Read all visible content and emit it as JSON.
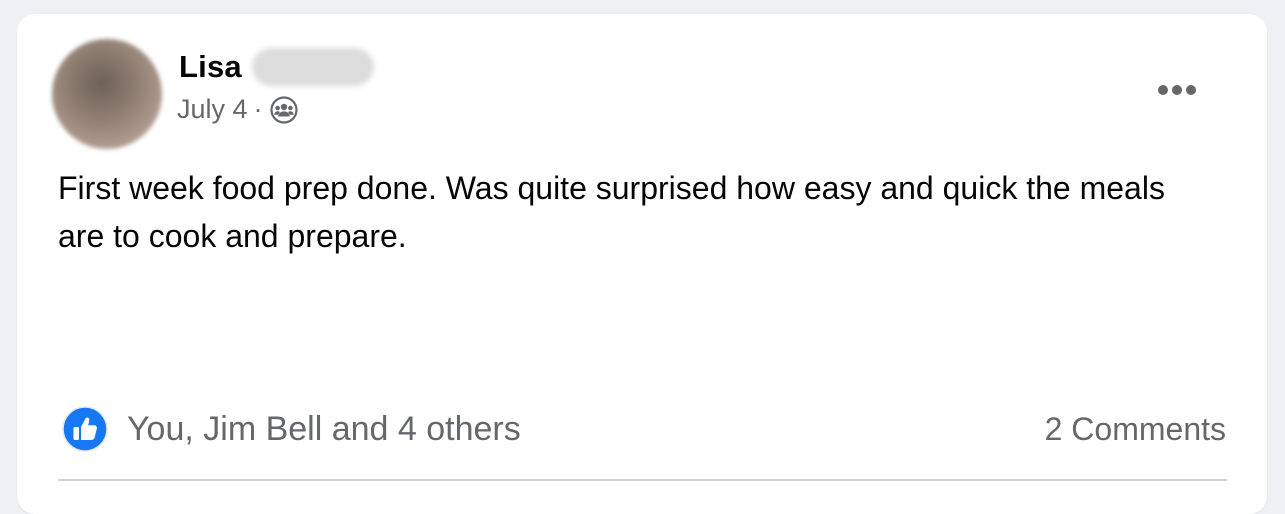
{
  "post": {
    "author_first_name": "Lisa",
    "date": "July 4",
    "separator": "·",
    "audience_icon": "friends-icon",
    "text": "First week food prep done. Was quite surprised how easy and quick the meals are to cook and prepare.",
    "more_icon": "more-options-icon"
  },
  "engagement": {
    "reaction_icon": "like-icon",
    "reactions_text": "You, Jim Bell and 4 others",
    "comments_text": "2 Comments"
  },
  "colors": {
    "background": "#eef0f3",
    "card": "#ffffff",
    "primary_text": "#050505",
    "secondary_text": "#65676b",
    "like_blue": "#1877f2",
    "divider": "#ced0d4"
  }
}
